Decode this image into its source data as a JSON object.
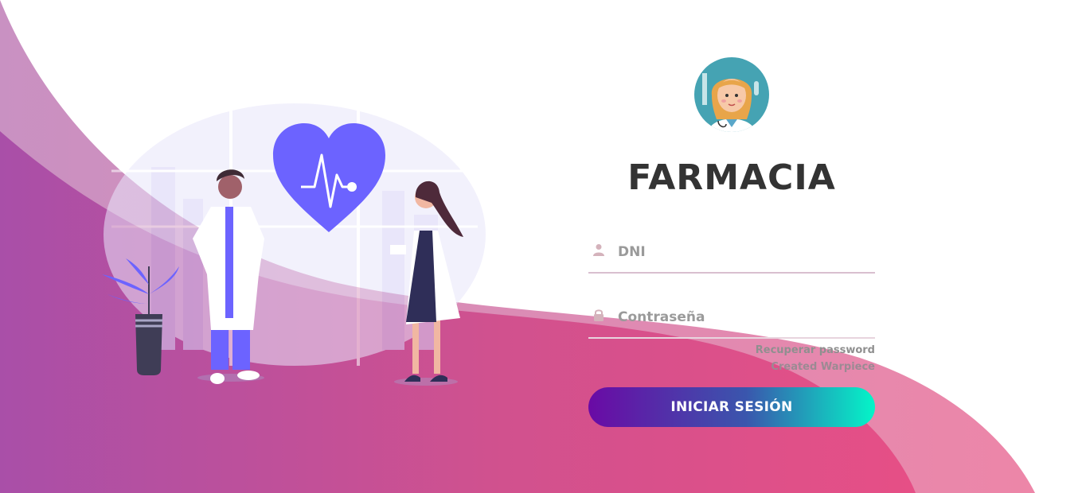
{
  "brand": {
    "title": "FARMACIA"
  },
  "form": {
    "user_placeholder": "DNI",
    "user_value": "",
    "password_placeholder": "Contraseña",
    "password_value": "",
    "recover_link": "Recuperar password",
    "credit_link": "Created Warpiece",
    "submit_label": "INICIAR SESIÓN"
  },
  "icons": {
    "user": "user-icon",
    "lock": "lock-icon",
    "heart": "heart-pulse-icon"
  },
  "colors": {
    "wave_start": "#a94fa8",
    "wave_end": "#e64f86",
    "button_start": "#6a0aa5",
    "button_end": "#04f5c8",
    "accent": "#6c63ff",
    "title": "#333333"
  }
}
